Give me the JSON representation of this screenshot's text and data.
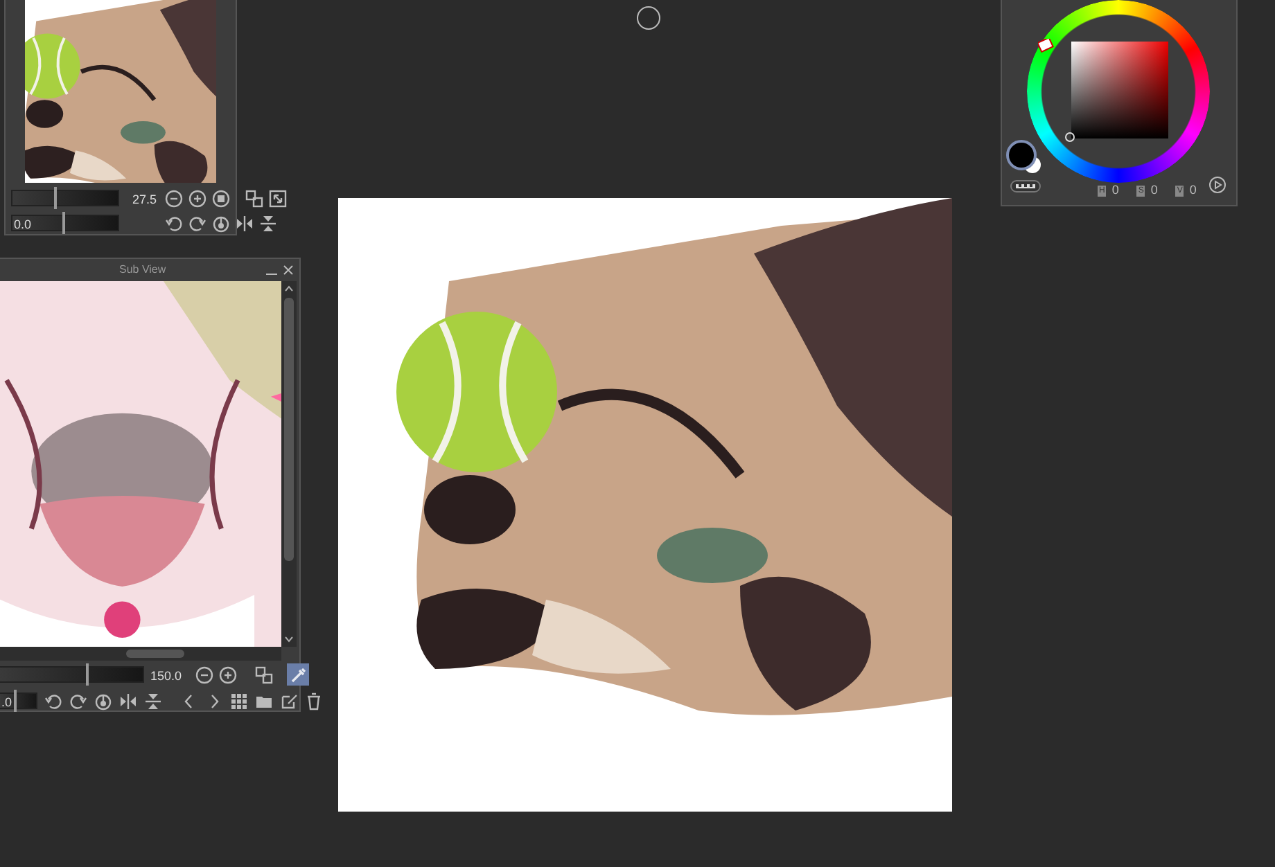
{
  "navigator": {
    "zoom": {
      "reading": "27.5",
      "level": 0.4
    },
    "rotation": {
      "reading": "0.0",
      "level": 0.47
    }
  },
  "sub_view": {
    "title": "Sub View",
    "zoom": {
      "reading": "150.0",
      "level": 0.6
    },
    "rotation": {
      "reading": ".0",
      "level": 0.4
    },
    "eyedropper_on": true
  },
  "color_panel": {
    "channels": [
      {
        "label": "H",
        "value": "0"
      },
      {
        "label": "S",
        "value": "0"
      },
      {
        "label": "V",
        "value": "0"
      }
    ]
  }
}
